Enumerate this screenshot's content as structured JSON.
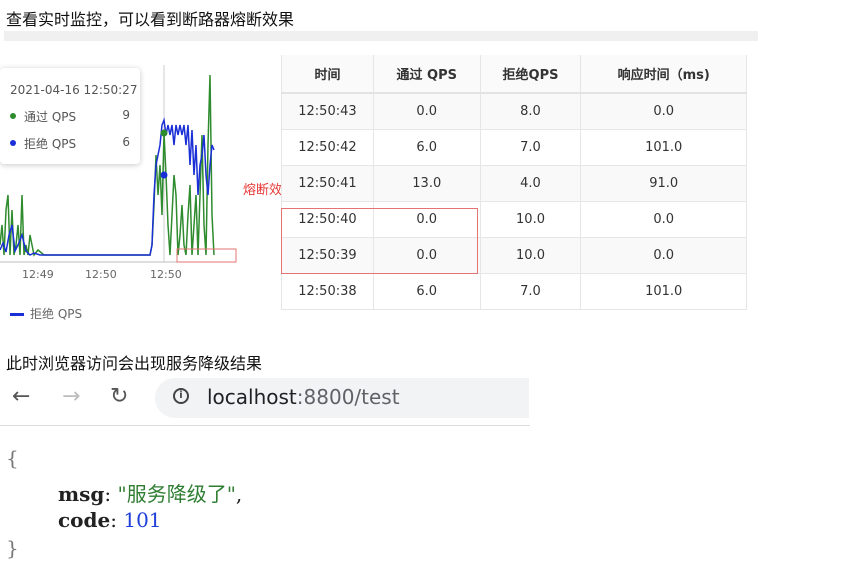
{
  "headings": {
    "monitor": "查看实时监控，可以看到断路器熔断效果",
    "browser": "此时浏览器访问会出现服务降级结果"
  },
  "chart": {
    "tooltip": {
      "time": "2021-04-16 12:50:27",
      "pass_label": "通过 QPS",
      "pass_value": "9",
      "reject_label": "拒绝 QPS",
      "reject_value": "6"
    },
    "x_ticks": [
      "12:49",
      "12:50",
      "12:50"
    ],
    "legend_reject": "拒绝 QPS",
    "colors": {
      "pass": "#2e8b2e",
      "reject": "#1a2fd6"
    }
  },
  "annotation": "熔断效果",
  "table": {
    "headers": [
      "时间",
      "通过 QPS",
      "拒绝QPS",
      "响应时间（ms)"
    ],
    "rows": [
      [
        "12:50:43",
        "0.0",
        "8.0",
        "0.0"
      ],
      [
        "12:50:42",
        "6.0",
        "7.0",
        "101.0"
      ],
      [
        "12:50:41",
        "13.0",
        "4.0",
        "91.0"
      ],
      [
        "12:50:40",
        "0.0",
        "10.0",
        "0.0"
      ],
      [
        "12:50:39",
        "0.0",
        "10.0",
        "0.0"
      ],
      [
        "12:50:38",
        "6.0",
        "7.0",
        "101.0"
      ]
    ]
  },
  "browser": {
    "back_icon": "arrow-left-icon",
    "forward_icon": "arrow-right-icon",
    "reload_icon": "reload-icon",
    "info_icon": "info-icon",
    "url_host": "localhost",
    "url_rest": ":8800/test"
  },
  "json_view": {
    "open": "{",
    "close": "}",
    "msg_key": "msg",
    "msg_value": "\"服务降级了\"",
    "code_key": "code",
    "code_value": "101"
  }
}
